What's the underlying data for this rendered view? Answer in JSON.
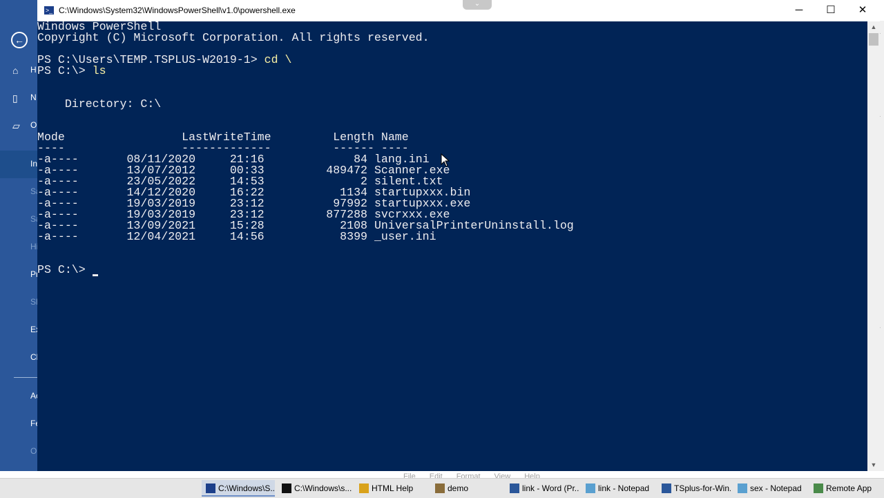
{
  "window": {
    "title": "C:\\Windows\\System32\\WindowsPowerShell\\v1.0\\powershell.exe",
    "minimize_glyph": "─",
    "maximize_glyph": "☐",
    "close_glyph": "✕"
  },
  "console": {
    "lines": [
      {
        "text": "Windows PowerShell",
        "row": 0
      },
      {
        "text": "Copyright (C) Microsoft Corporation. All rights reserved.",
        "row": 1
      },
      {
        "prompt": "PS C:\\Users\\TEMP.TSPLUS-W2019-1> ",
        "command": "cd \\",
        "row": 3
      },
      {
        "prompt": "PS C:\\> ",
        "command": "ls",
        "row": 4
      },
      {
        "text": "    Directory: C:\\",
        "row": 7
      },
      {
        "text": "Mode                 LastWriteTime         Length Name",
        "row": 10
      },
      {
        "text": "----                 -------------         ------ ----",
        "row": 11
      }
    ],
    "files": [
      {
        "mode": "-a----",
        "date": "08/11/2020",
        "time": "21:16",
        "length": "84",
        "name": "lang.ini"
      },
      {
        "mode": "-a----",
        "date": "13/07/2012",
        "time": "00:33",
        "length": "489472",
        "name": "Scanner.exe"
      },
      {
        "mode": "-a----",
        "date": "23/05/2022",
        "time": "14:53",
        "length": "2",
        "name": "silent.txt"
      },
      {
        "mode": "-a----",
        "date": "14/12/2020",
        "time": "16:22",
        "length": "1134",
        "name": "startupxxx.bin"
      },
      {
        "mode": "-a----",
        "date": "19/03/2019",
        "time": "23:12",
        "length": "97992",
        "name": "startupxxx.exe"
      },
      {
        "mode": "-a----",
        "date": "19/03/2019",
        "time": "23:12",
        "length": "877288",
        "name": "svcrxxx.exe"
      },
      {
        "mode": "-a----",
        "date": "13/09/2021",
        "time": "15:28",
        "length": "2108",
        "name": "UniversalPrinterUninstall.log"
      },
      {
        "mode": "-a----",
        "date": "12/04/2021",
        "time": "14:56",
        "length": "8399",
        "name": "_user.ini"
      }
    ],
    "final_prompt": "PS C:\\> ",
    "background_color": "#012456",
    "text_color": "#eeedf0",
    "command_color": "#f9f1a5"
  },
  "backstage": {
    "back_glyph": "←",
    "items": [
      {
        "label": "H",
        "icon": "home-icon",
        "glyph": "⌂"
      },
      {
        "label": "N",
        "icon": "new-doc-icon",
        "glyph": "▯"
      },
      {
        "label": "O",
        "icon": "open-folder-icon",
        "glyph": "▱"
      },
      {
        "label": "In"
      },
      {
        "label": "Sa"
      },
      {
        "label": "Sa"
      },
      {
        "label": "Hi"
      },
      {
        "label": "Pr"
      },
      {
        "label": "Sh"
      },
      {
        "label": "Ex"
      },
      {
        "label": "Cl"
      },
      {
        "label": "Ac"
      },
      {
        "label": "Fe"
      },
      {
        "label": "O"
      }
    ],
    "accent": "#2b579a"
  },
  "peek_menu": [
    "File",
    "Edit",
    "Format",
    "View",
    "Help"
  ],
  "taskbar": {
    "items": [
      {
        "label": "C:\\Windows\\S...",
        "icon": "powershell-icon",
        "active": true
      },
      {
        "label": "C:\\Windows\\s...",
        "icon": "cmd-icon",
        "active": false
      },
      {
        "label": "HTML Help",
        "icon": "help-icon",
        "active": false
      },
      {
        "label": "demo",
        "icon": "user-icon",
        "active": false
      },
      {
        "label": "link - Word (Pr...",
        "icon": "word-icon",
        "active": false
      },
      {
        "label": "link - Notepad",
        "icon": "notepad-icon",
        "active": false
      },
      {
        "label": "TSplus-for-Win...",
        "icon": "word-icon",
        "active": false
      },
      {
        "label": "sex - Notepad",
        "icon": "notepad-icon",
        "active": false
      },
      {
        "label": "Remote App",
        "icon": "remote-app-icon",
        "active": false
      }
    ]
  }
}
